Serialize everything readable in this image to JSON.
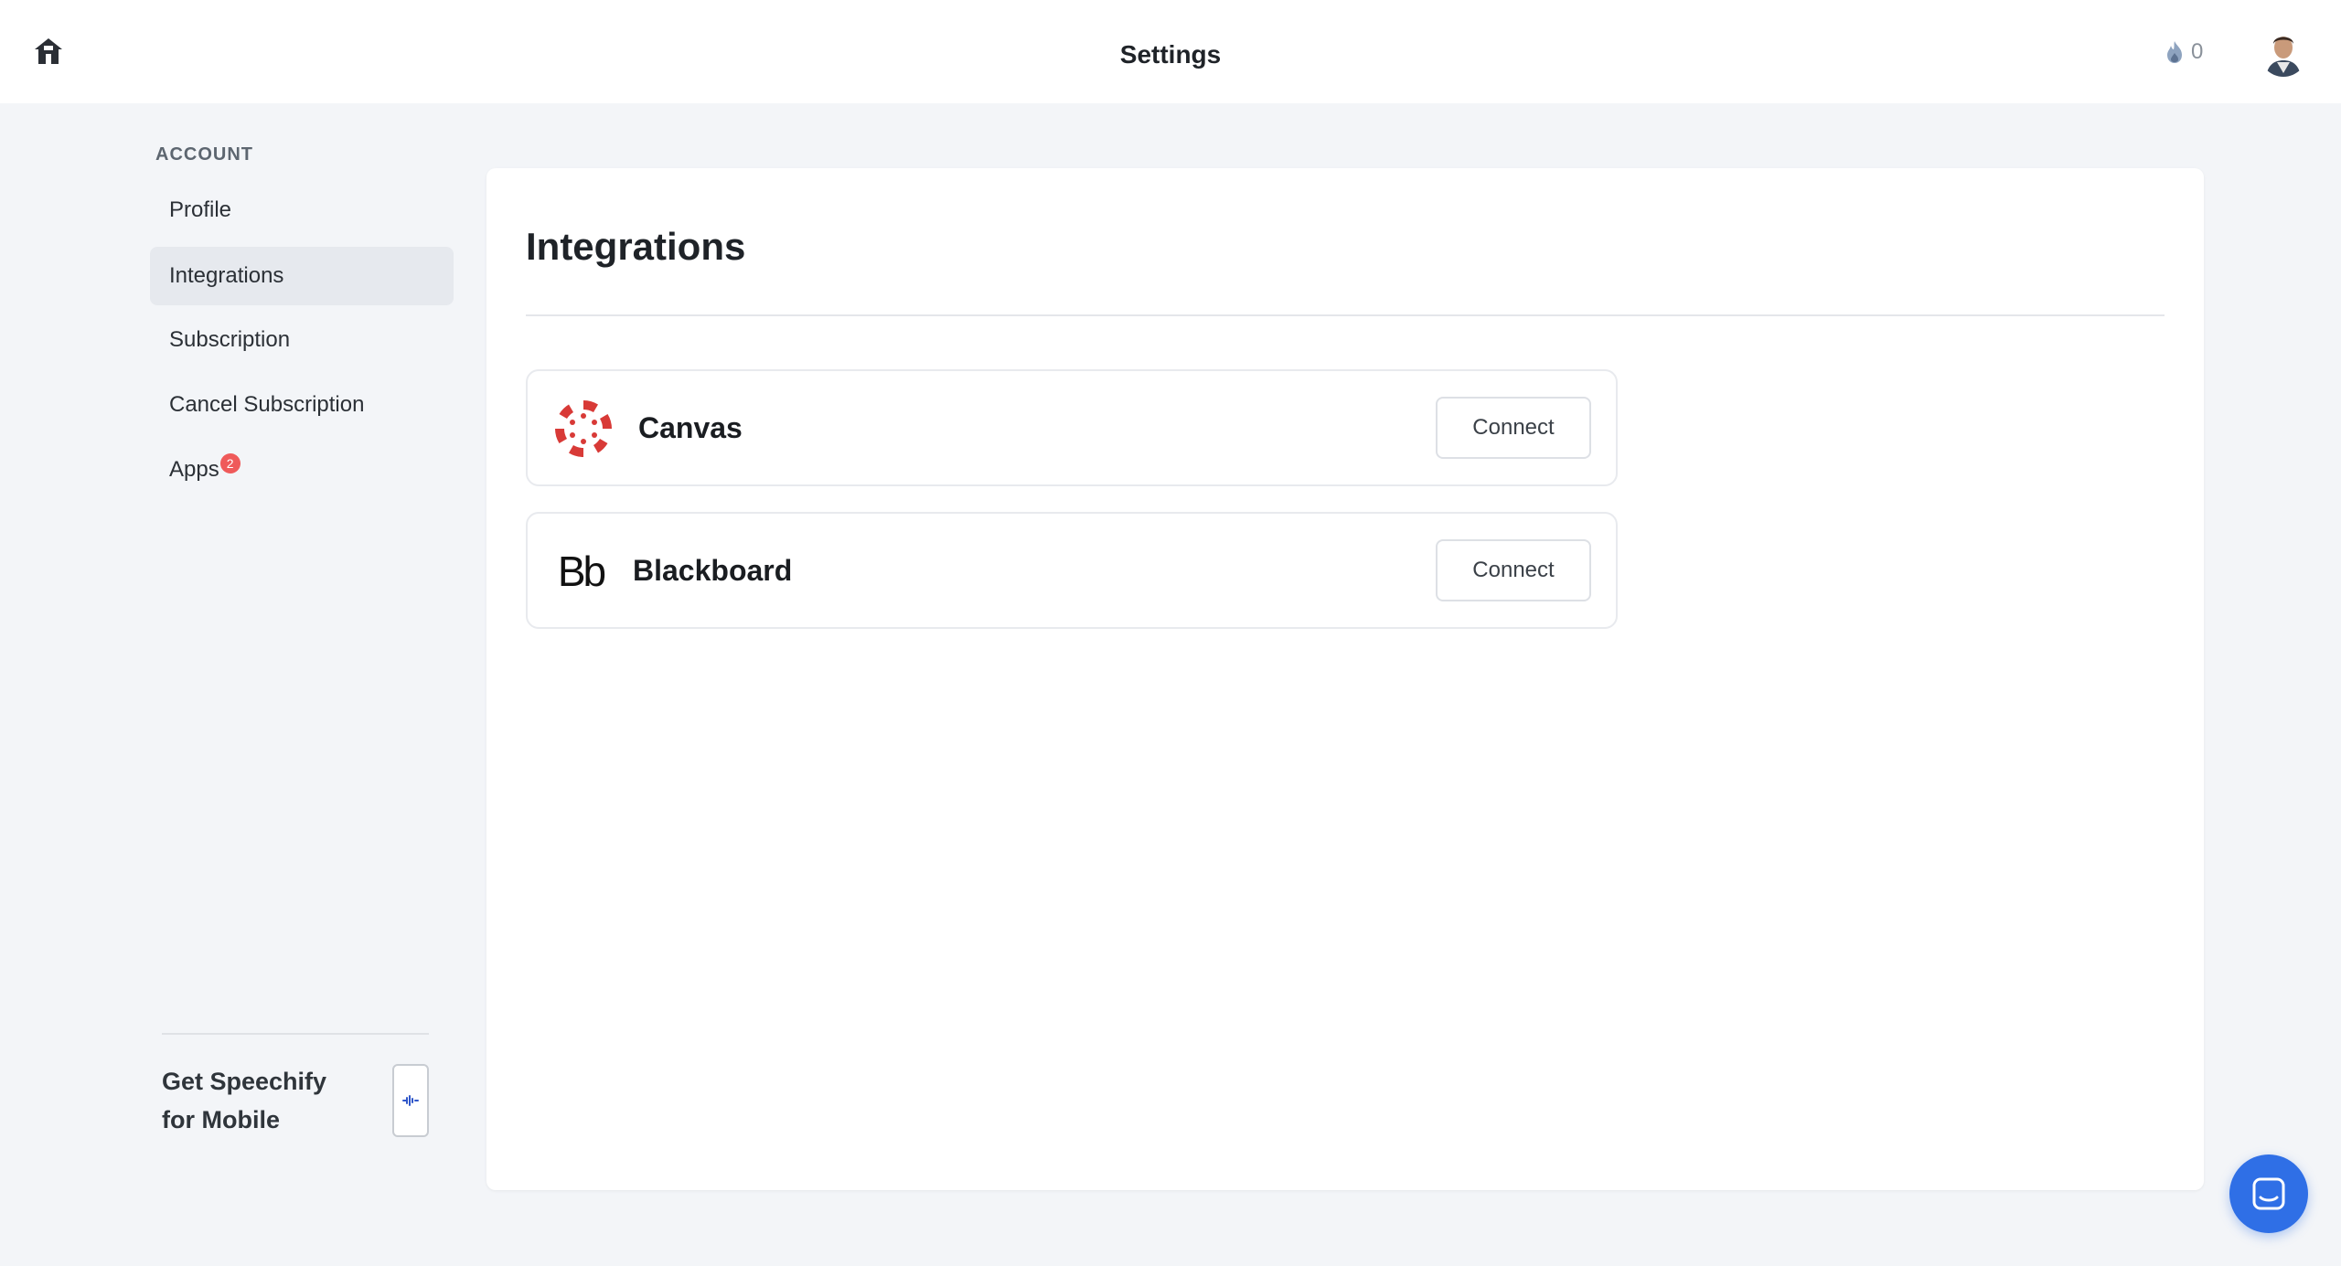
{
  "header": {
    "title": "Settings",
    "streak_count": "0",
    "home_icon": "home-icon",
    "streak_icon": "flame-icon"
  },
  "sidebar": {
    "section_label": "ACCOUNT",
    "items": [
      {
        "label": "Profile",
        "active": false
      },
      {
        "label": "Integrations",
        "active": true
      },
      {
        "label": "Subscription",
        "active": false
      },
      {
        "label": "Cancel Subscription",
        "active": false
      },
      {
        "label": "Apps",
        "active": false,
        "badge": "2"
      }
    ],
    "promo": {
      "text": "Get Speechify for Mobile",
      "icon": "phone-icon"
    }
  },
  "main": {
    "title": "Integrations",
    "integrations": [
      {
        "name": "Canvas",
        "button_label": "Connect",
        "logo": "canvas-logo"
      },
      {
        "name": "Blackboard",
        "logo_text": "Bb",
        "button_label": "Connect",
        "logo": "blackboard-logo"
      }
    ]
  },
  "colors": {
    "background": "#f3f5f8",
    "card": "#ffffff",
    "active_nav": "#e6e9ee",
    "badge": "#ef5a5a",
    "canvas_red": "#d83a37",
    "chat_blue": "#2f6fe6"
  },
  "chat": {
    "icon": "chat-icon"
  }
}
